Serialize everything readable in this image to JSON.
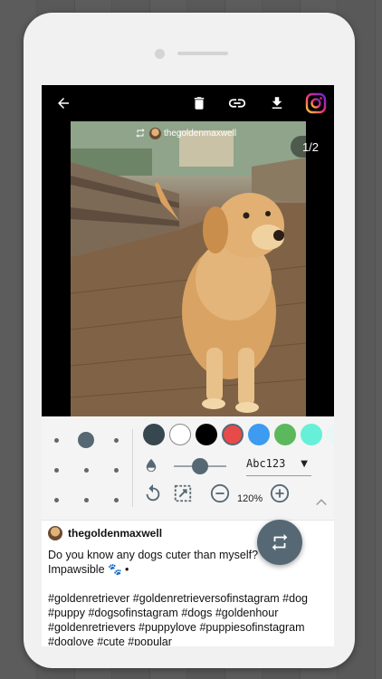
{
  "photo": {
    "username_tag": "thegoldenmaxwell",
    "pager": "1/2"
  },
  "toolbar": {
    "icons": [
      "back-arrow-icon",
      "delete-icon",
      "link-icon",
      "download-icon",
      "instagram-icon"
    ]
  },
  "editor": {
    "colors": [
      "#37474f",
      "#ffffff",
      "#000000",
      "#e84a4a",
      "#3d9bf0",
      "#5cb85c",
      "#66f0d8",
      "#e6f7f5"
    ],
    "selected_color": "#e84a4a",
    "accent": "#566874",
    "font_sample": "Abc123",
    "zoom": "120%"
  },
  "caption": {
    "username": "thegoldenmaxwell",
    "text": "Do you know any dogs cuter than myself? 🐾 Impawsible 🐾 •\n\n#goldenretriever #goldenretrieversofinstagram #dog #puppy #dogsofinstagram #dogs #goldenhour #goldenretrievers #puppylove #puppiesofinstagram #doglove #cute #popular"
  }
}
